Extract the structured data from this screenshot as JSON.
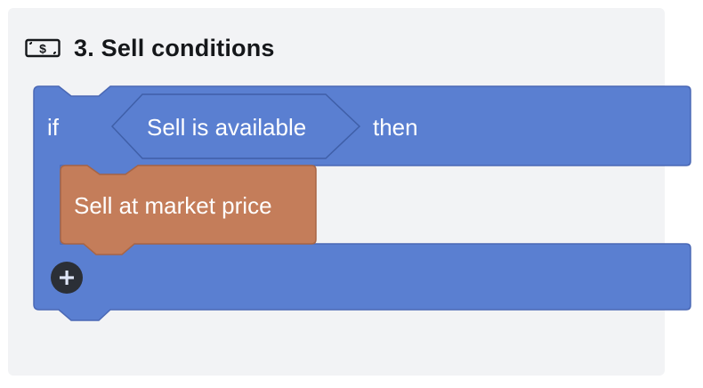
{
  "section": {
    "icon": "money-bill-icon",
    "title": "3. Sell conditions"
  },
  "if_block": {
    "if_label": "if",
    "condition_label": "Sell is available",
    "then_label": "then",
    "color": "#5a7fd1"
  },
  "action_block": {
    "label": "Sell at market price",
    "color": "#c47d5a"
  },
  "add_button": {
    "icon": "plus-icon"
  }
}
